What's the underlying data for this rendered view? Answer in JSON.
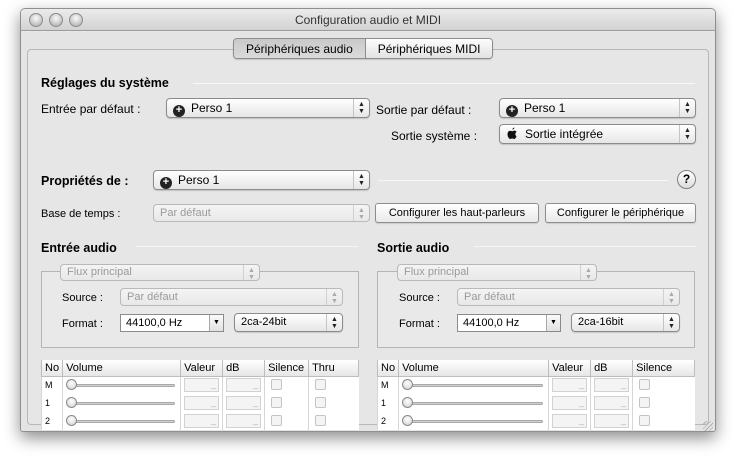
{
  "window": {
    "title": "Configuration audio et MIDI"
  },
  "tabs": [
    {
      "label": "Périphériques audio",
      "selected": true
    },
    {
      "label": "Périphériques MIDI",
      "selected": false
    }
  ],
  "system": {
    "heading": "Réglages du système",
    "default_input_label": "Entrée par défaut :",
    "default_input_value": "Perso 1",
    "default_output_label": "Sortie par défaut :",
    "default_output_value": "Perso 1",
    "system_output_label": "Sortie système :",
    "system_output_value": "Sortie intégrée"
  },
  "properties": {
    "label": "Propriétés de :",
    "device": "Perso 1",
    "help": "?",
    "clock_label": "Base de temps :",
    "clock_value": "Par défaut",
    "configure_speakers": "Configurer les haut-parleurs",
    "configure_device": "Configurer le périphérique"
  },
  "input": {
    "heading": "Entrée audio",
    "stream": "Flux principal",
    "source_label": "Source :",
    "source_value": "Par défaut",
    "format_label": "Format :",
    "rate": "44100,0 Hz",
    "bits": "2ca-24bit",
    "columns": [
      "No",
      "Volume",
      "Valeur",
      "dB",
      "Silence",
      "Thru"
    ],
    "rows": [
      "M",
      "1",
      "2"
    ]
  },
  "output": {
    "heading": "Sortie audio",
    "stream": "Flux principal",
    "source_label": "Source :",
    "source_value": "Par défaut",
    "format_label": "Format :",
    "rate": "44100,0 Hz",
    "bits": "2ca-16bit",
    "columns": [
      "No",
      "Volume",
      "Valeur",
      "dB",
      "Silence"
    ],
    "rows": [
      "M",
      "1",
      "2"
    ]
  },
  "icons": {
    "plus_device": "plus-circle-icon",
    "apple_device": "apple-icon",
    "field_placeholder": "_"
  },
  "colors": {
    "window_bg": "#e4e4e4",
    "disabled_text": "#9a9a9a"
  }
}
